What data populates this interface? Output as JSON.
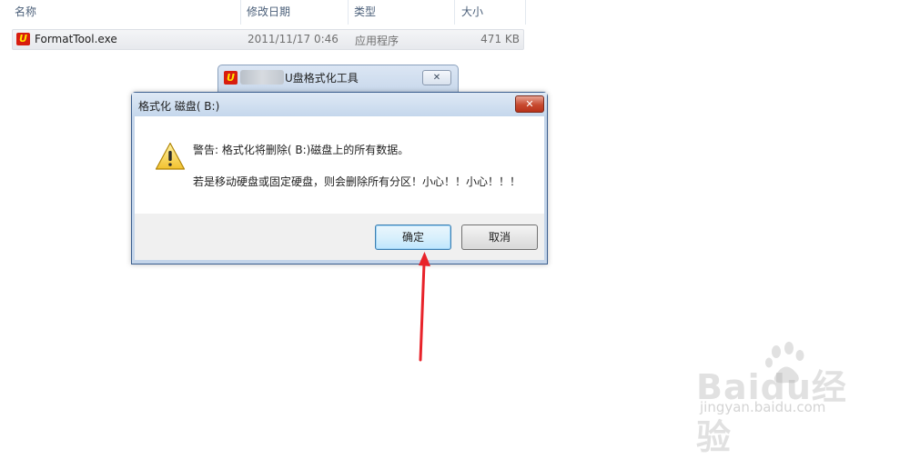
{
  "explorer": {
    "columns": [
      "名称",
      "修改日期",
      "类型",
      "大小"
    ],
    "sort_indicator": "^",
    "file": {
      "name": "FormatTool.exe",
      "modified": "2011/11/17 0:46",
      "type": "应用程序",
      "size": "471 KB",
      "icon": "u-disk-format-icon"
    }
  },
  "app_window": {
    "title": "U盘格式化工具",
    "close": "✕",
    "icon_letter": "U"
  },
  "dialog": {
    "title": "格式化 磁盘( B:)",
    "close": "✕",
    "message1": "警告: 格式化将删除( B:)磁盘上的所有数据。",
    "message2": "若是移动硬盘或固定硬盘，则会删除所有分区！小心！！小心！！！",
    "ok_label": "确定",
    "cancel_label": "取消"
  },
  "annotation": {
    "arrow_color": "#e8232a"
  },
  "watermark": {
    "brand": "Baidu经验",
    "url": "jingyan.baidu.com"
  },
  "colors": {
    "dialog_border": "#3c5f8e",
    "close_red": "#c74a2f",
    "ok_border": "#3c7fb1",
    "exe_icon_red": "#d81d0f"
  }
}
